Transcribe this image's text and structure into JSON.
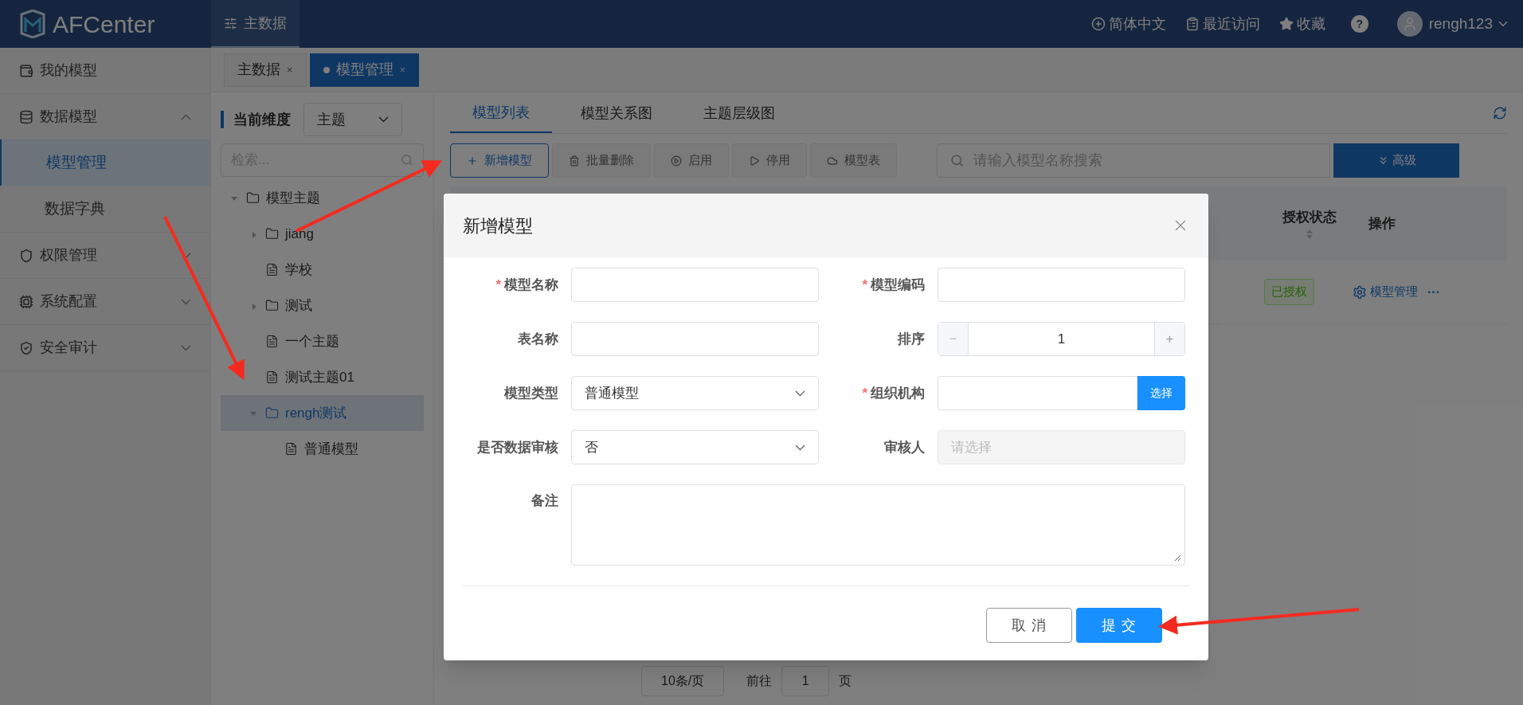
{
  "header": {
    "logo": "AFCenter",
    "nav": [
      {
        "label": "主数据",
        "selected": true
      }
    ],
    "actions": [
      {
        "kind": "lang",
        "label": "简体中文"
      },
      {
        "kind": "recent",
        "label": "最近访问"
      },
      {
        "kind": "star",
        "label": "收藏"
      },
      {
        "kind": "help",
        "label": "?"
      }
    ],
    "user": "rengh123"
  },
  "sidebar": {
    "items": [
      {
        "label": "我的模型",
        "kind": "wallet"
      },
      {
        "label": "数据模型",
        "kind": "db",
        "expanded": true,
        "children": [
          {
            "label": "模型管理",
            "selected": true
          },
          {
            "label": "数据字典",
            "selected": false
          }
        ]
      },
      {
        "label": "权限管理",
        "kind": "shield",
        "expanded": false
      },
      {
        "label": "系统配置",
        "kind": "chip",
        "expanded": false
      },
      {
        "label": "安全审计",
        "kind": "audit",
        "expanded": false
      }
    ]
  },
  "page_tabs": [
    {
      "label": "主数据",
      "selected": false,
      "close": "×"
    },
    {
      "label": "模型管理",
      "selected": true,
      "close": "×"
    }
  ],
  "tree_panel": {
    "dimension_label": "当前维度",
    "dimension_value": "主题",
    "search_placeholder": "检索...",
    "tree": [
      {
        "label": "模型主题",
        "kind": "folder",
        "expanded": true,
        "selected": false,
        "children": [
          {
            "label": "jiang",
            "kind": "folder",
            "expanded": false,
            "selected": false
          },
          {
            "label": "学校",
            "kind": "file",
            "selected": false
          },
          {
            "label": "测试",
            "kind": "folder",
            "expanded": false,
            "selected": false
          },
          {
            "label": "一个主题",
            "kind": "file",
            "selected": false
          },
          {
            "label": "测试主题01",
            "kind": "file",
            "selected": false
          },
          {
            "label": "rengh测试",
            "kind": "folder",
            "expanded": true,
            "selected": true,
            "children": [
              {
                "label": "普通模型",
                "kind": "file",
                "selected": false
              }
            ]
          }
        ]
      }
    ]
  },
  "content_tabs": [
    {
      "label": "模型列表",
      "selected": true
    },
    {
      "label": "模型关系图",
      "selected": false
    },
    {
      "label": "主题层级图",
      "selected": false
    }
  ],
  "toolbar": [
    {
      "label": "新增模型",
      "kind": "plus",
      "disabled": false
    },
    {
      "label": "批量删除",
      "kind": "trash",
      "disabled": true
    },
    {
      "label": "启用",
      "kind": "play-circle",
      "disabled": true
    },
    {
      "label": "停用",
      "kind": "play",
      "disabled": true
    },
    {
      "label": "模型表",
      "kind": "cloud",
      "disabled": true
    }
  ],
  "search": {
    "placeholder": "请输入模型名称搜索"
  },
  "advanced_button": "高级",
  "table": {
    "columns": [
      "授权状态",
      "操作"
    ],
    "rows": [
      {
        "status": "已授权",
        "action": "模型管理",
        "more": "···"
      }
    ]
  },
  "pagination": {
    "page_size": "10条/页",
    "goto": "前往",
    "page": "1",
    "unit": "页"
  },
  "dialog": {
    "title": "新增模型",
    "fields": [
      {
        "label": "模型名称",
        "mark": "*",
        "kind": "text"
      },
      {
        "label": "模型编码",
        "mark": "*",
        "kind": "text"
      },
      {
        "label": "表名称",
        "kind": "text"
      },
      {
        "label": "排序",
        "kind": "number",
        "value": "1",
        "minus": "−",
        "plus": "+"
      },
      {
        "label": "模型类型",
        "kind": "select",
        "value": "普通模型"
      },
      {
        "label": "组织机构",
        "mark": "*",
        "kind": "picker",
        "button": "选择"
      },
      {
        "label": "是否数据审核",
        "kind": "select",
        "value": "否"
      },
      {
        "label": "审核人",
        "kind": "disabled",
        "placeholder": "请选择"
      },
      {
        "label": "备注",
        "kind": "textarea"
      }
    ],
    "buttons": [
      {
        "label": "取 消",
        "kind": "cancel"
      },
      {
        "label": "提 交",
        "kind": "primary"
      }
    ]
  }
}
